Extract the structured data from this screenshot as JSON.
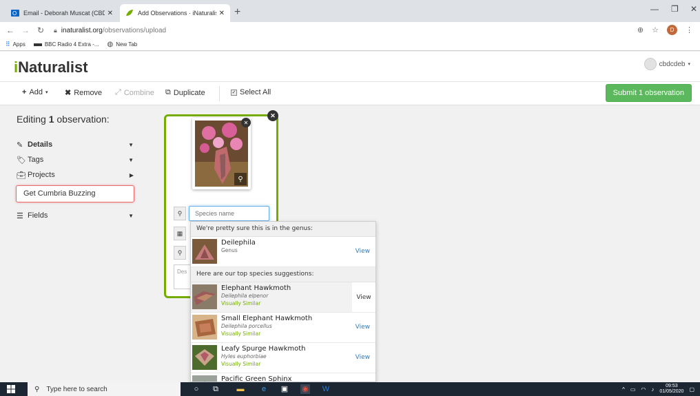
{
  "browser": {
    "tabs": [
      {
        "title": "Email - Deborah Muscat (CBDC)",
        "active": false
      },
      {
        "title": "Add Observations · iNaturalist",
        "active": true
      }
    ],
    "url_host": "inaturalist.org",
    "url_path": "/observations/upload",
    "profile_initial": "D",
    "bookmarks": [
      {
        "label": "Apps",
        "icon": "apps-grid-icon"
      },
      {
        "label": "BBC Radio 4 Extra -...",
        "icon": "radio-icon"
      },
      {
        "label": "New Tab",
        "icon": "globe-icon"
      }
    ]
  },
  "site": {
    "logo_i": "i",
    "logo_rest": "Naturalist",
    "username": "cbdcdeb",
    "brand_color": "#74ac00"
  },
  "toolbar": {
    "add_label": "Add",
    "remove_label": "Remove",
    "combine_label": "Combine",
    "duplicate_label": "Duplicate",
    "select_all_label": "Select All",
    "submit_label": "Submit 1 observation"
  },
  "left_panel": {
    "editing_prefix": "Editing",
    "editing_count": "1",
    "editing_suffix": "observation:",
    "sections": {
      "details": "Details",
      "tags": "Tags",
      "projects": "Projects",
      "fields": "Fields"
    },
    "project_value": "Get Cumbria Buzzing"
  },
  "card": {
    "species_placeholder": "Species name",
    "description_placeholder": "Des"
  },
  "suggestions": {
    "genus_header": "We're pretty sure this is in the genus:",
    "genus": {
      "name": "Deilephila",
      "rank": "Genus",
      "view": "View"
    },
    "species_header": "Here are our top species suggestions:",
    "species": [
      {
        "name": "Elephant Hawkmoth",
        "scientific": "Deilephila elpenor",
        "tag": "Visually Similar",
        "view": "View"
      },
      {
        "name": "Small Elephant Hawkmoth",
        "scientific": "Deilephila porcellus",
        "tag": "Visually Similar",
        "view": "View"
      },
      {
        "name": "Leafy Spurge Hawkmoth",
        "scientific": "Hyles euphorbiae",
        "tag": "Visually Similar",
        "view": "View"
      },
      {
        "name": "Pacific Green Sphinx",
        "scientific": "",
        "tag": "",
        "view": ""
      }
    ]
  },
  "taskbar": {
    "search_placeholder": "Type here to search",
    "time": "09:53",
    "date": "01/05/2020"
  }
}
